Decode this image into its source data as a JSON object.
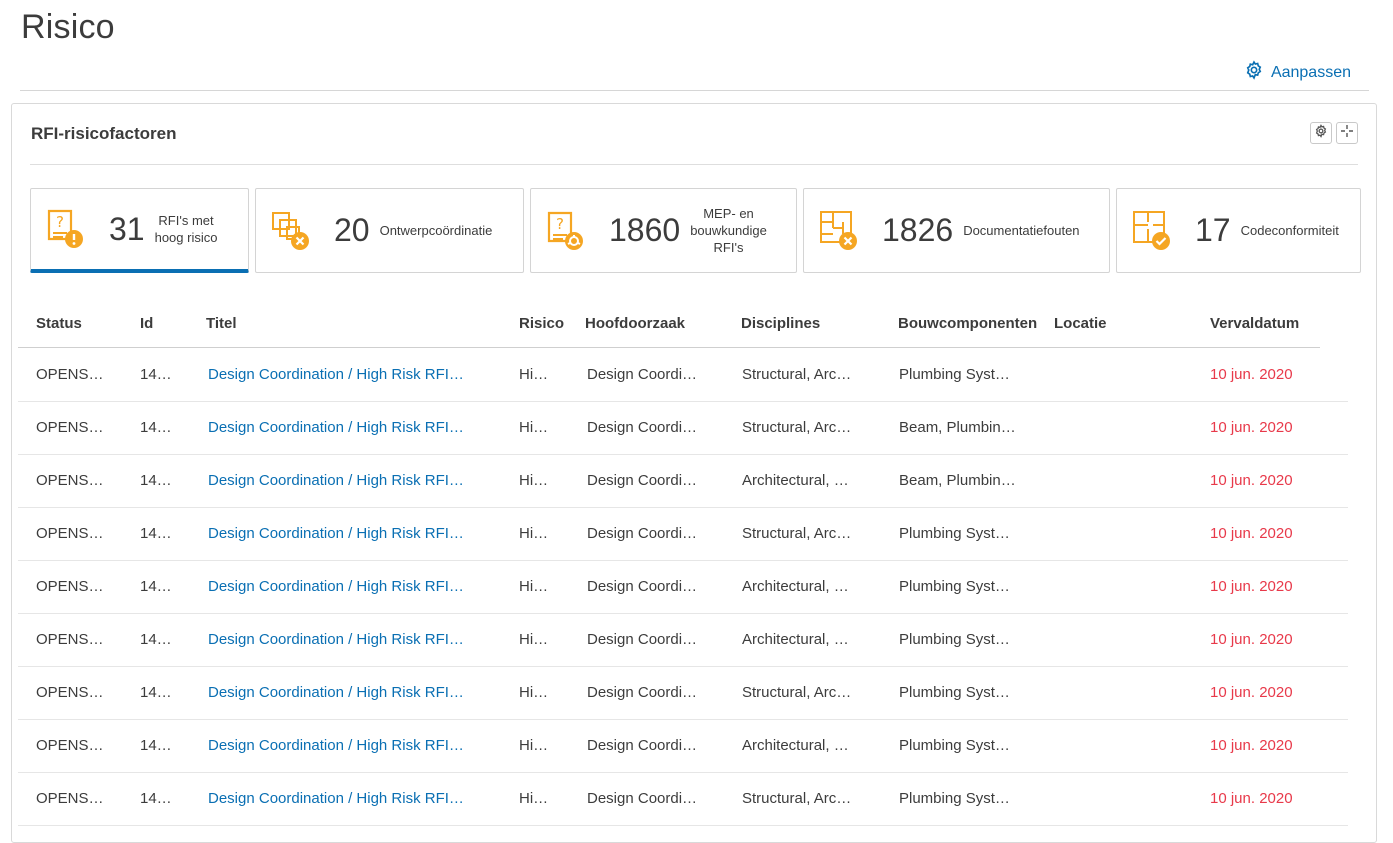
{
  "page": {
    "title": "Risico",
    "customize_label": "Aanpassen"
  },
  "card": {
    "title": "RFI-risicofactoren"
  },
  "kpis": [
    {
      "value": "31",
      "label_lines": [
        "RFI's met",
        "hoog risico"
      ]
    },
    {
      "value": "20",
      "label_lines": [
        "Ontwerpcoördinatie"
      ]
    },
    {
      "value": "1860",
      "label_lines": [
        "MEP- en",
        "bouwkundige",
        "RFI's"
      ]
    },
    {
      "value": "1826",
      "label_lines": [
        "Documentatiefouten"
      ]
    },
    {
      "value": "17",
      "label_lines": [
        "Codeconformiteit"
      ]
    }
  ],
  "table": {
    "columns": [
      "Status",
      "Id",
      "Titel",
      "Risico",
      "Hoofdoorzaak",
      "Disciplines",
      "Bouwcomponenten",
      "Locatie",
      "Vervaldatum"
    ],
    "rows": [
      [
        "OPENS…",
        "14…",
        "Design Coordination / High Risk RFI…",
        "Hi…",
        "Design Coordi…",
        "Structural, Arc…",
        "Plumbing Syst…",
        "",
        "10 jun. 2020"
      ],
      [
        "OPENS…",
        "14…",
        "Design Coordination / High Risk RFI…",
        "Hi…",
        "Design Coordi…",
        "Structural, Arc…",
        "Beam, Plumbin…",
        "",
        "10 jun. 2020"
      ],
      [
        "OPENS…",
        "14…",
        "Design Coordination / High Risk RFI…",
        "Hi…",
        "Design Coordi…",
        "Architectural, …",
        "Beam, Plumbin…",
        "",
        "10 jun. 2020"
      ],
      [
        "OPENS…",
        "14…",
        "Design Coordination / High Risk RFI…",
        "Hi…",
        "Design Coordi…",
        "Structural, Arc…",
        "Plumbing Syst…",
        "",
        "10 jun. 2020"
      ],
      [
        "OPENS…",
        "14…",
        "Design Coordination / High Risk RFI…",
        "Hi…",
        "Design Coordi…",
        "Architectural, …",
        "Plumbing Syst…",
        "",
        "10 jun. 2020"
      ],
      [
        "OPENS…",
        "14…",
        "Design Coordination / High Risk RFI…",
        "Hi…",
        "Design Coordi…",
        "Architectural, …",
        "Plumbing Syst…",
        "",
        "10 jun. 2020"
      ],
      [
        "OPENS…",
        "14…",
        "Design Coordination / High Risk RFI…",
        "Hi…",
        "Design Coordi…",
        "Structural, Arc…",
        "Plumbing Syst…",
        "",
        "10 jun. 2020"
      ],
      [
        "OPENS…",
        "14…",
        "Design Coordination / High Risk RFI…",
        "Hi…",
        "Design Coordi…",
        "Architectural, …",
        "Plumbing Syst…",
        "",
        "10 jun. 2020"
      ],
      [
        "OPENS…",
        "14…",
        "Design Coordination / High Risk RFI…",
        "Hi…",
        "Design Coordi…",
        "Structural, Arc…",
        "Plumbing Syst…",
        "",
        "10 jun. 2020"
      ]
    ]
  },
  "colors": {
    "accent": "#0a6fb3",
    "icon_orange": "#f5a623",
    "due_red": "#e8394a"
  }
}
